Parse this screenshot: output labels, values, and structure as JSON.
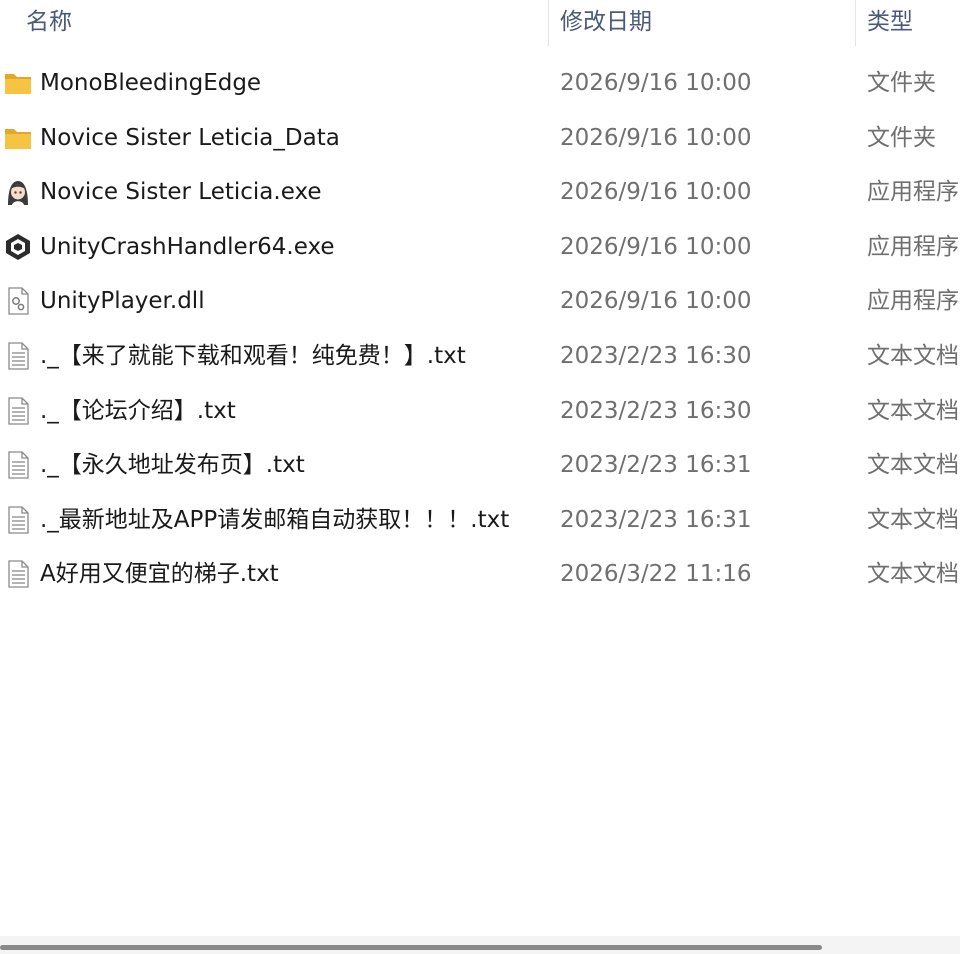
{
  "columns": {
    "name": "名称",
    "date": "修改日期",
    "type": "类型",
    "sort_icon": "sort-ascending-icon"
  },
  "files": [
    {
      "name": "MonoBleedingEdge",
      "date": "2026/9/16 10:00",
      "type": "文件夹",
      "icon": "folder-icon"
    },
    {
      "name": "Novice Sister Leticia_Data",
      "date": "2026/9/16 10:00",
      "type": "文件夹",
      "icon": "folder-icon"
    },
    {
      "name": "Novice Sister Leticia.exe",
      "date": "2026/9/16 10:00",
      "type": "应用程序",
      "icon": "app-character-icon"
    },
    {
      "name": "UnityCrashHandler64.exe",
      "date": "2026/9/16 10:00",
      "type": "应用程序",
      "icon": "unity-icon"
    },
    {
      "name": "UnityPlayer.dll",
      "date": "2026/9/16 10:00",
      "type": "应用程序",
      "icon": "dll-icon"
    },
    {
      "name": "._【来了就能下载和观看！纯免费！】.txt",
      "date": "2023/2/23 16:30",
      "type": "文本文档",
      "icon": "text-file-icon"
    },
    {
      "name": "._【论坛介绍】.txt",
      "date": "2023/2/23 16:30",
      "type": "文本文档",
      "icon": "text-file-icon"
    },
    {
      "name": "._【永久地址发布页】.txt",
      "date": "2023/2/23 16:31",
      "type": "文本文档",
      "icon": "text-file-icon"
    },
    {
      "name": "._最新地址及APP请发邮箱自动获取！！！.txt",
      "date": "2023/2/23 16:31",
      "type": "文本文档",
      "icon": "text-file-icon"
    },
    {
      "name": "A好用又便宜的梯子.txt",
      "date": "2026/3/22 11:16",
      "type": "文本文档",
      "icon": "text-file-icon"
    }
  ],
  "colors": {
    "folder": "#f5c443",
    "folder_dark": "#e3a82b",
    "header_text": "#4a5a78",
    "name_text": "#1a1a1a",
    "meta_text": "#6f6f6f"
  }
}
